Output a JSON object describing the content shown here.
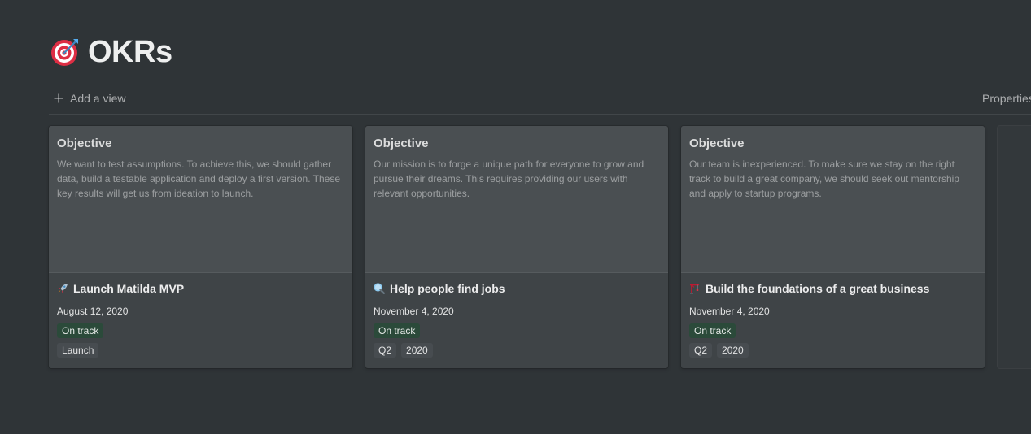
{
  "page": {
    "title": "OKRs",
    "icon": "target-icon"
  },
  "toolbar": {
    "add_view_label": "Add a view",
    "properties_label": "Properties"
  },
  "cards": [
    {
      "cover_heading": "Objective",
      "cover_text": "We want to test assumptions. To achieve this, we should gather data, build a testable application and deploy a first version. These key results will get us from ideation to launch.",
      "icon": "rocket-icon",
      "title": "Launch Matilda MVP",
      "date": "August 12, 2020",
      "status": "On track",
      "tags": [
        "Launch"
      ]
    },
    {
      "cover_heading": "Objective",
      "cover_text": "Our mission is to forge a unique path for everyone to grow and pursue their dreams. This requires providing our users with relevant opportunities.",
      "icon": "magnifying-glass-icon",
      "title": "Help people find jobs",
      "date": "November 4, 2020",
      "status": "On track",
      "tags": [
        "Q2",
        "2020"
      ]
    },
    {
      "cover_heading": "Objective",
      "cover_text": "Our team is inexperienced. To make sure we stay on the right track to build a great company, we should seek out mentorship and apply to startup programs.",
      "icon": "construction-crane-icon",
      "title": "Build the foundations of a great business",
      "date": "November 4, 2020",
      "status": "On track",
      "tags": [
        "Q2",
        "2020"
      ]
    }
  ],
  "colors": {
    "background": "#2f3437",
    "card": "#3f4447",
    "cover": "#4a4f52",
    "status_green": "#2b4a3a",
    "tag": "#474c50"
  }
}
